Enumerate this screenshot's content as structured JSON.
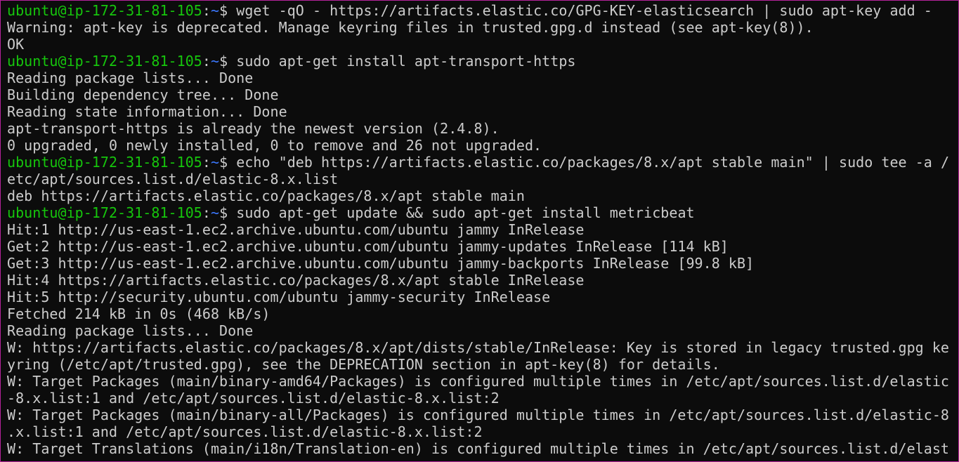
{
  "prompt": {
    "user_host": "ubuntu@ip-172-31-81-105",
    "separator": ":",
    "path": "~",
    "symbol": "$ "
  },
  "lines": [
    {
      "type": "prompt",
      "command": "wget -qO - https://artifacts.elastic.co/GPG-KEY-elasticsearch | sudo apt-key add -"
    },
    {
      "type": "output",
      "text": "Warning: apt-key is deprecated. Manage keyring files in trusted.gpg.d instead (see apt-key(8))."
    },
    {
      "type": "output",
      "text": "OK"
    },
    {
      "type": "prompt",
      "command": "sudo apt-get install apt-transport-https"
    },
    {
      "type": "output",
      "text": "Reading package lists... Done"
    },
    {
      "type": "output",
      "text": "Building dependency tree... Done"
    },
    {
      "type": "output",
      "text": "Reading state information... Done"
    },
    {
      "type": "output",
      "text": "apt-transport-https is already the newest version (2.4.8)."
    },
    {
      "type": "output",
      "text": "0 upgraded, 0 newly installed, 0 to remove and 26 not upgraded."
    },
    {
      "type": "prompt",
      "command": "echo \"deb https://artifacts.elastic.co/packages/8.x/apt stable main\" | sudo tee -a /"
    },
    {
      "type": "output",
      "text": "etc/apt/sources.list.d/elastic-8.x.list"
    },
    {
      "type": "output",
      "text": "deb https://artifacts.elastic.co/packages/8.x/apt stable main"
    },
    {
      "type": "prompt",
      "command": "sudo apt-get update && sudo apt-get install metricbeat"
    },
    {
      "type": "output",
      "text": "Hit:1 http://us-east-1.ec2.archive.ubuntu.com/ubuntu jammy InRelease"
    },
    {
      "type": "output",
      "text": "Get:2 http://us-east-1.ec2.archive.ubuntu.com/ubuntu jammy-updates InRelease [114 kB]"
    },
    {
      "type": "output",
      "text": "Get:3 http://us-east-1.ec2.archive.ubuntu.com/ubuntu jammy-backports InRelease [99.8 kB]"
    },
    {
      "type": "output",
      "text": "Hit:4 https://artifacts.elastic.co/packages/8.x/apt stable InRelease"
    },
    {
      "type": "output",
      "text": "Hit:5 http://security.ubuntu.com/ubuntu jammy-security InRelease"
    },
    {
      "type": "output",
      "text": "Fetched 214 kB in 0s (468 kB/s)"
    },
    {
      "type": "output",
      "text": "Reading package lists... Done"
    },
    {
      "type": "output",
      "text": "W: https://artifacts.elastic.co/packages/8.x/apt/dists/stable/InRelease: Key is stored in legacy trusted.gpg ke"
    },
    {
      "type": "output",
      "text": "yring (/etc/apt/trusted.gpg), see the DEPRECATION section in apt-key(8) for details."
    },
    {
      "type": "output",
      "text": "W: Target Packages (main/binary-amd64/Packages) is configured multiple times in /etc/apt/sources.list.d/elastic"
    },
    {
      "type": "output",
      "text": "-8.x.list:1 and /etc/apt/sources.list.d/elastic-8.x.list:2"
    },
    {
      "type": "output",
      "text": "W: Target Packages (main/binary-all/Packages) is configured multiple times in /etc/apt/sources.list.d/elastic-8"
    },
    {
      "type": "output",
      "text": ".x.list:1 and /etc/apt/sources.list.d/elastic-8.x.list:2"
    },
    {
      "type": "output",
      "text": "W: Target Translations (main/i18n/Translation-en) is configured multiple times in /etc/apt/sources.list.d/elast"
    }
  ],
  "colors": {
    "background": "#0c0c0c",
    "text": "#cccccc",
    "user_host": "#16c60c",
    "path": "#3b78ff",
    "window_border": "#b4239a"
  }
}
